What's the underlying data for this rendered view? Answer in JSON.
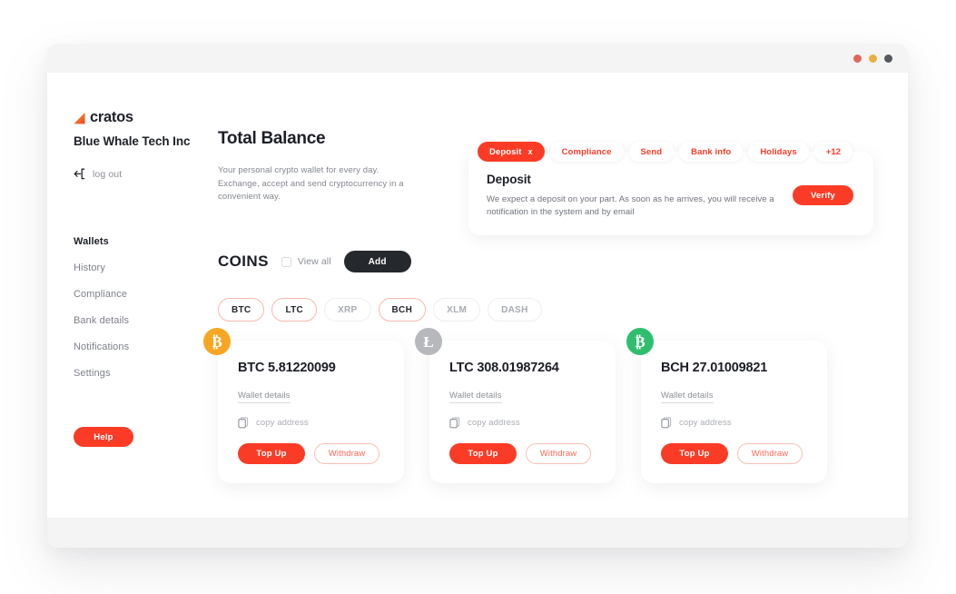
{
  "window": {
    "dots": [
      "close-dot",
      "minimize-dot",
      "maximize-dot"
    ],
    "accent_color": "#FA3C26",
    "dark_color": "#25282D"
  },
  "sidebar": {
    "brand": "cratos",
    "company": "Blue Whale Tech Inc",
    "logout_label": "log out",
    "items": [
      {
        "label": "Wallets",
        "active": true
      },
      {
        "label": "History",
        "active": false
      },
      {
        "label": "Compliance",
        "active": false
      },
      {
        "label": "Bank details",
        "active": false
      },
      {
        "label": "Notifications",
        "active": false
      },
      {
        "label": "Settings",
        "active": false
      }
    ],
    "help_label": "Help"
  },
  "balance": {
    "title": "Total Balance",
    "description": "Your personal crypto wallet for every day. Exchange, accept and send cryptocurrency in a convenient way."
  },
  "notifications": {
    "tabs": [
      {
        "label": "Deposit",
        "active": true,
        "closable": true,
        "close_glyph": "x"
      },
      {
        "label": "Compliance",
        "active": false,
        "closable": false
      },
      {
        "label": "Send",
        "active": false,
        "closable": false
      },
      {
        "label": "Bank info",
        "active": false,
        "closable": false
      },
      {
        "label": "Holidays",
        "active": false,
        "closable": false
      },
      {
        "label": "+12",
        "active": false,
        "closable": false
      }
    ],
    "card": {
      "title": "Deposit",
      "text": "We expect a deposit on your part. As soon as he arrives, you will receive a notification in the system and by email",
      "action_label": "Verify"
    }
  },
  "coins_section": {
    "title": "COINS",
    "view_all_label": "View all",
    "view_all_checked": false,
    "add_label": "Add",
    "chips": [
      {
        "label": "BTC",
        "selected": true
      },
      {
        "label": "LTC",
        "selected": true
      },
      {
        "label": "XRP",
        "selected": false
      },
      {
        "label": "BCH",
        "selected": true
      },
      {
        "label": "XLM",
        "selected": false
      },
      {
        "label": "DASH",
        "selected": false
      }
    ]
  },
  "wallets": [
    {
      "amount": "BTC 5.81220099",
      "badge_glyph": "₿",
      "badge_color": "#F7A623",
      "details_label": "Wallet details",
      "copy_label": "copy address",
      "topup_label": "Top Up",
      "withdraw_label": "Withdraw"
    },
    {
      "amount": "LTC 308.01987264",
      "badge_glyph": "Ł",
      "badge_color": "#B6B8BB",
      "details_label": "Wallet details",
      "copy_label": "copy address",
      "topup_label": "Top Up",
      "withdraw_label": "Withdraw"
    },
    {
      "amount": "BCH 27.01009821",
      "badge_glyph": "₿",
      "badge_color": "#2FBE6E",
      "details_label": "Wallet details",
      "copy_label": "copy address",
      "topup_label": "Top Up",
      "withdraw_label": "Withdraw"
    }
  ]
}
